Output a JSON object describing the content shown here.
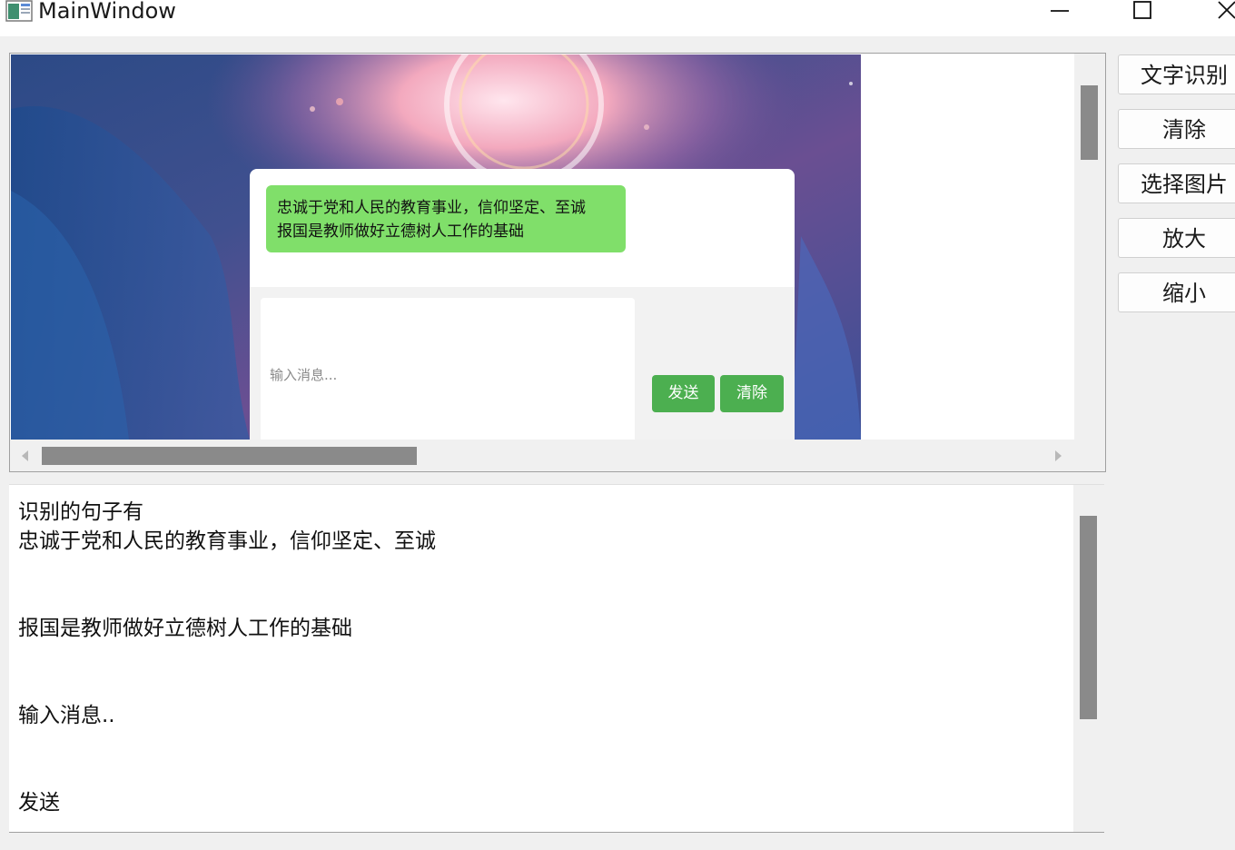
{
  "window": {
    "title": "MainWindow",
    "icon": "app-window-icon"
  },
  "image_panel": {
    "chat_card": {
      "bubble_line1": "忠诚于党和人民的教育事业，信仰坚定、至诚",
      "bubble_line2": "报国是教师做好立德树人工作的基础",
      "input_placeholder": "输入消息...",
      "send_label": "发送",
      "clear_label": "清除"
    }
  },
  "side_buttons": {
    "ocr": "文字识别",
    "clear": "清除",
    "select_image": "选择图片",
    "zoom_in": "放大",
    "zoom_out": "缩小"
  },
  "output": {
    "lines": [
      "识别的句子有",
      "忠诚于党和人民的教育事业，信仰坚定、至诚",
      "报国是教师做好立德树人工作的基础",
      "输入消息..",
      "发送"
    ]
  },
  "colors": {
    "bubble": "#80df6a",
    "button_green": "#4caf50",
    "scroll_thumb": "#8a8a8a"
  }
}
